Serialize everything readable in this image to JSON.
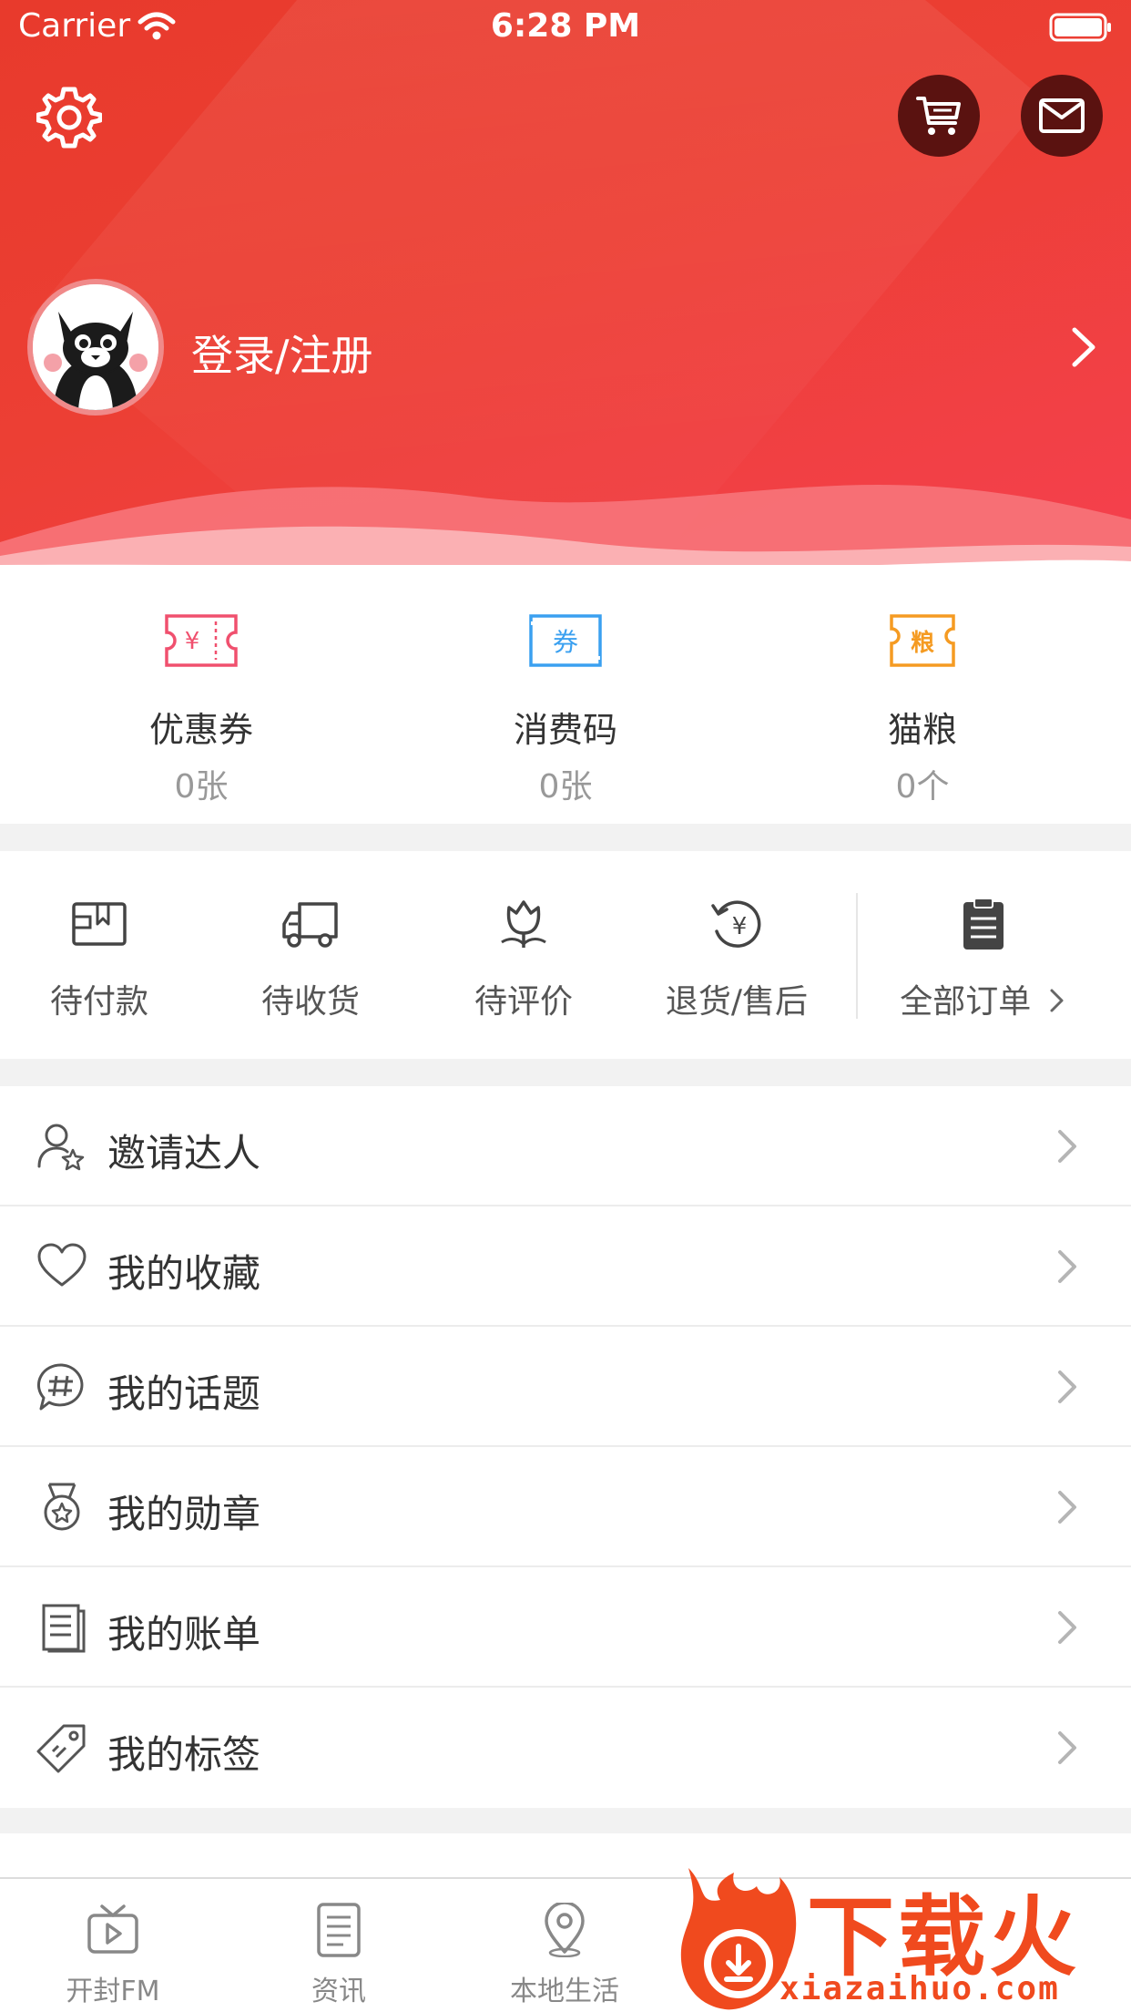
{
  "status_bar": {
    "carrier": "Carrier",
    "time": "6:28 PM"
  },
  "header": {
    "login_label": "登录/注册"
  },
  "wallet": [
    {
      "label": "优惠券",
      "count": "0张",
      "icon": "coupon-yen-icon",
      "icon_text": "¥",
      "color": "#f0506e"
    },
    {
      "label": "消费码",
      "count": "0张",
      "icon": "voucher-icon",
      "icon_text": "券",
      "color": "#3aa0f0"
    },
    {
      "label": "猫粮",
      "count": "0个",
      "icon": "cat-food-icon",
      "icon_text": "粮",
      "color": "#f59b22"
    }
  ],
  "orders": [
    {
      "label": "待付款",
      "icon": "wallet-icon"
    },
    {
      "label": "待收货",
      "icon": "delivery-truck-icon"
    },
    {
      "label": "待评价",
      "icon": "flower-review-icon"
    },
    {
      "label": "退货/售后",
      "icon": "refund-icon"
    },
    {
      "label": "全部订单",
      "icon": "clipboard-icon"
    }
  ],
  "menu": [
    {
      "label": "邀请达人",
      "icon": "invite-user-icon"
    },
    {
      "label": "我的收藏",
      "icon": "heart-icon"
    },
    {
      "label": "我的话题",
      "icon": "hashtag-chat-icon"
    },
    {
      "label": "我的勋章",
      "icon": "medal-icon"
    },
    {
      "label": "我的账单",
      "icon": "bill-icon"
    },
    {
      "label": "我的标签",
      "icon": "tag-icon"
    }
  ],
  "tabs": [
    {
      "label": "开封FM",
      "icon": "tv-play-icon"
    },
    {
      "label": "资讯",
      "icon": "news-list-icon"
    },
    {
      "label": "本地生活",
      "icon": "location-pin-icon"
    }
  ],
  "watermark": {
    "text": "下载火",
    "url": "xiazaihuo.com"
  },
  "colors": {
    "header_red": "#ec3f34",
    "accent_orange": "#f04a1e"
  }
}
